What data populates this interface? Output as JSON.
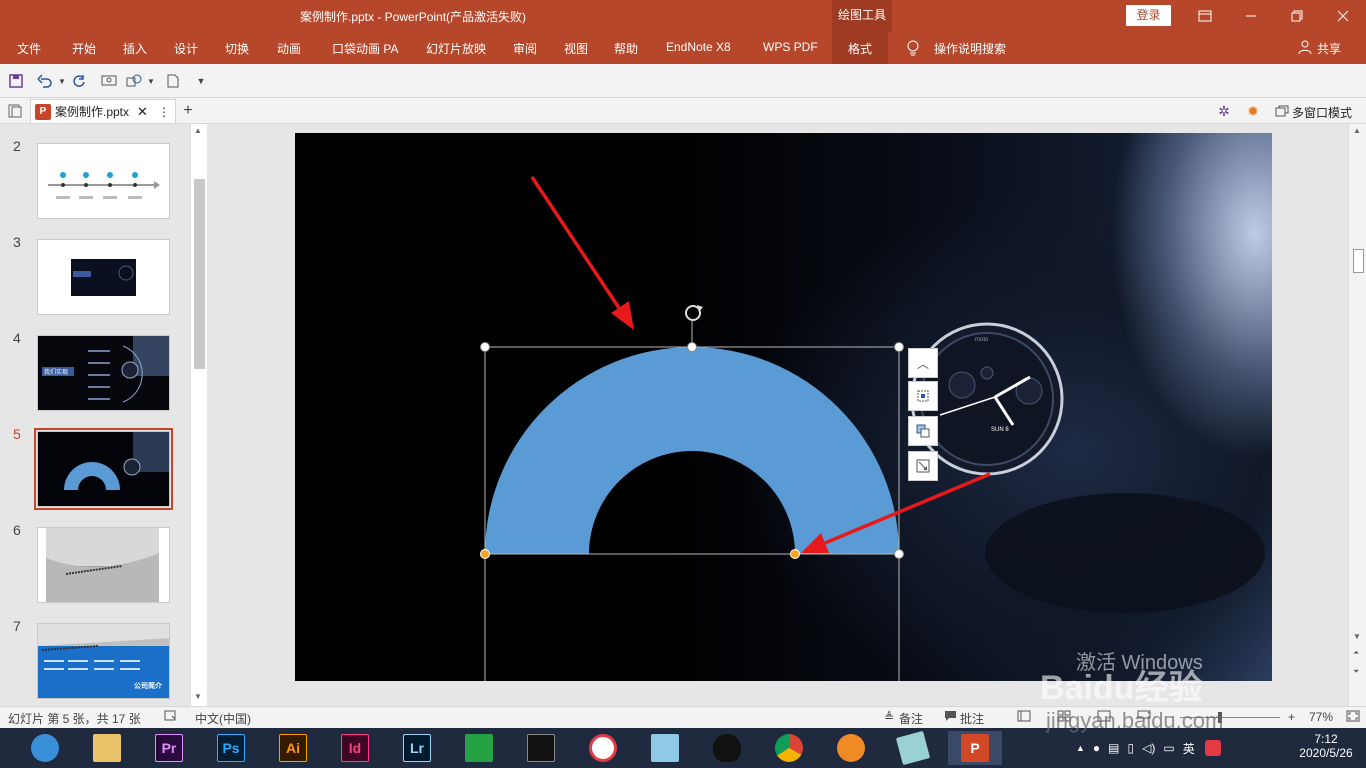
{
  "window": {
    "title": "案例制作.pptx  -  PowerPoint(产品激活失败)",
    "tool_tab": "绘图工具",
    "login_label": "登录"
  },
  "ribbon": {
    "tabs": [
      "文件",
      "开始",
      "插入",
      "设计",
      "切换",
      "动画",
      "口袋动画 PA",
      "幻灯片放映",
      "审阅",
      "视图",
      "帮助",
      "EndNote X8",
      "WPS PDF",
      "格式"
    ],
    "active_tab": "格式",
    "search_label": "操作说明搜索",
    "share_label": "共享"
  },
  "docbar": {
    "file_tab": "案例制作.pptx",
    "multiwindow_label": "多窗口模式"
  },
  "thumbnails": {
    "numbers": [
      "2",
      "3",
      "4",
      "5",
      "6",
      "7"
    ],
    "selected": "5",
    "slide4_caption": "我们实现",
    "slide7_title": "公司简介"
  },
  "slide": {
    "shape": "block-arc",
    "shape_color": "#5b9bd5",
    "arrow_color": "#e8191b",
    "watch": {
      "brand": "moto",
      "date": "SUN 8"
    }
  },
  "statusbar": {
    "slide_info": "幻灯片 第 5 张，共 17 张",
    "language": "中文(中国)",
    "notes_label": "备注",
    "comments_label": "批注",
    "zoom": "77%"
  },
  "taskbar": {
    "apps": [
      "Pr",
      "Ps",
      "Ai",
      "Id",
      "Lr"
    ],
    "ime": "英",
    "time": "7:12",
    "date": "2020/5/26"
  },
  "watermarks": {
    "activate_windows": "激活 Windows",
    "baidu": "Baidu经验",
    "url": "jingyan.baidu.com"
  }
}
